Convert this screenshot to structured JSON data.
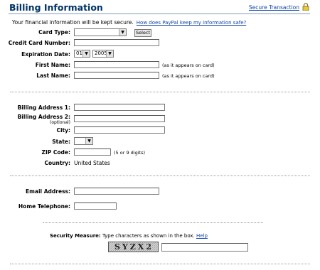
{
  "header": {
    "title": "Billing Information",
    "secure_link": "Secure Transaction",
    "lock_icon": "lock-icon"
  },
  "intro": {
    "text": "Your financial information will be kept secure.",
    "link": "How does PayPal keep my information safe?"
  },
  "card_section": {
    "card_type_label": "Card Type:",
    "card_type_value": "",
    "select_button": "Select",
    "card_number_label": "Credit Card Number:",
    "expiration_label": "Expiration Date:",
    "exp_month": "01",
    "exp_year": "2005",
    "first_name_label": "First Name:",
    "last_name_label": "Last Name:",
    "as_on_card": "(as it appears on card)"
  },
  "address_section": {
    "address1_label": "Billing Address 1:",
    "address2_label": "Billing Address 2:",
    "optional": "(optional)",
    "city_label": "City:",
    "state_label": "State:",
    "state_value": "",
    "zip_label": "ZIP Code:",
    "zip_hint": "(5 or 9 digits)",
    "country_label": "Country:",
    "country_value": "United States"
  },
  "contact_section": {
    "email_label": "Email Address:",
    "phone_label": "Home Telephone:"
  },
  "security": {
    "label": "Security Measure:",
    "instructions": "Type characters as shown in the box.",
    "help_link": "Help",
    "captcha_text": "SYZX2"
  }
}
